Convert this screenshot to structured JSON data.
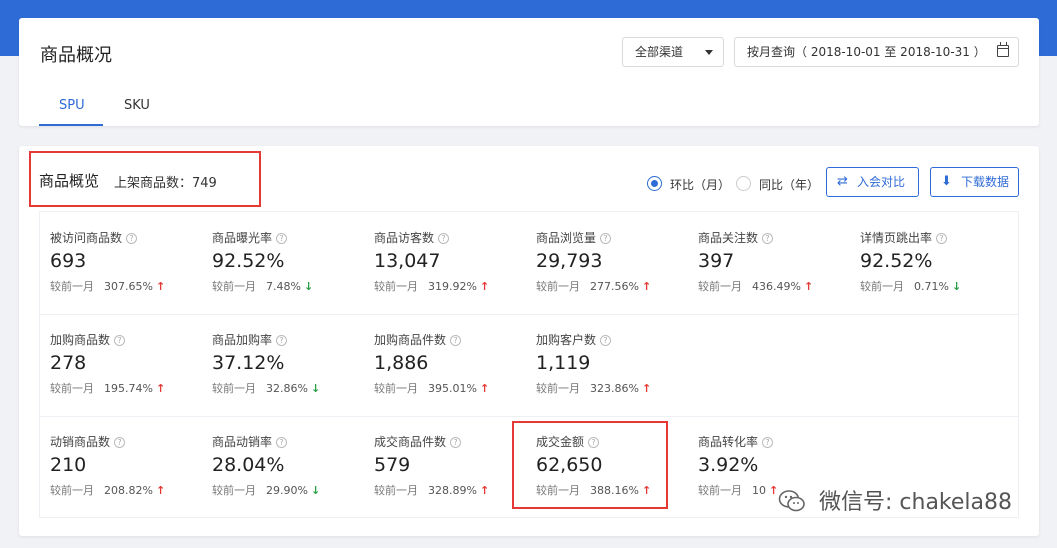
{
  "header": {
    "title": "商品概况",
    "channel": "全部渠道",
    "date_range": "按月查询（ 2018-10-01 至 2018-10-31 ）",
    "tabs": [
      "SPU",
      "SKU"
    ],
    "active_tab": "SPU",
    "accent_color": "#2f6bd6"
  },
  "overview": {
    "title": "商品概览",
    "count_label": "上架商品数：749",
    "compare": {
      "mom_label": "环比（月）",
      "yoy_label": "同比（年）",
      "selected": "mom"
    },
    "join_compare_label": "入会对比",
    "download_label": "下载数据",
    "compare_prefix": "较前一月",
    "rows": [
      [
        {
          "label": "被访问商品数",
          "value": "693",
          "pct": "307.65%",
          "dir": "up"
        },
        {
          "label": "商品曝光率",
          "value": "92.52%",
          "pct": "7.48%",
          "dir": "down"
        },
        {
          "label": "商品访客数",
          "value": "13,047",
          "pct": "319.92%",
          "dir": "up"
        },
        {
          "label": "商品浏览量",
          "value": "29,793",
          "pct": "277.56%",
          "dir": "up"
        },
        {
          "label": "商品关注数",
          "value": "397",
          "pct": "436.49%",
          "dir": "up"
        },
        {
          "label": "详情页跳出率",
          "value": "92.52%",
          "pct": "0.71%",
          "dir": "down"
        }
      ],
      [
        {
          "label": "加购商品数",
          "value": "278",
          "pct": "195.74%",
          "dir": "up"
        },
        {
          "label": "商品加购率",
          "value": "37.12%",
          "pct": "32.86%",
          "dir": "down"
        },
        {
          "label": "加购商品件数",
          "value": "1,886",
          "pct": "395.01%",
          "dir": "up"
        },
        {
          "label": "加购客户数",
          "value": "1,119",
          "pct": "323.86%",
          "dir": "up"
        }
      ],
      [
        {
          "label": "动销商品数",
          "value": "210",
          "pct": "208.82%",
          "dir": "up"
        },
        {
          "label": "商品动销率",
          "value": "28.04%",
          "pct": "29.90%",
          "dir": "down"
        },
        {
          "label": "成交商品件数",
          "value": "579",
          "pct": "328.89%",
          "dir": "up"
        },
        {
          "label": "成交金额",
          "value": "62,650",
          "pct": "388.16%",
          "dir": "up"
        },
        {
          "label": "商品转化率",
          "value": "3.92%",
          "pct": "10",
          "dir": "up"
        }
      ]
    ]
  },
  "watermark": "微信号: chakela88",
  "highlight_color": "#e53935"
}
